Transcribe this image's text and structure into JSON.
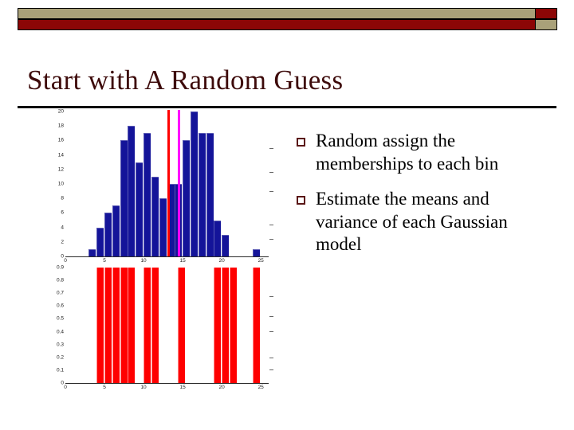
{
  "slide": {
    "title": "Start with A Random Guess",
    "title_color": "#3d0a0a",
    "decoration": {
      "top_bar_color": "#a9a179",
      "bottom_bar_color": "#8c0606",
      "outline_color": "#000000"
    },
    "bullets": [
      {
        "marker": "hollow-square",
        "text": "Random assign the memberships to each bin"
      },
      {
        "marker": "hollow-square",
        "text": "Estimate the means and variance of each Gaussian model"
      }
    ]
  },
  "chart_data": [
    {
      "type": "bar",
      "id": "histogram-counts",
      "title": "",
      "xlabel": "",
      "ylabel": "",
      "xlim": [
        0,
        26
      ],
      "ylim": [
        0,
        20
      ],
      "grid": false,
      "legend": null,
      "bar_color": "#141499",
      "xticks": [
        "0",
        "5",
        "10",
        "15",
        "20",
        "25"
      ],
      "xtick_values": [
        0,
        5,
        10,
        15,
        20,
        25
      ],
      "yticks": [
        "0",
        "2",
        "4",
        "6",
        "8",
        "10",
        "12",
        "14",
        "16",
        "18",
        "20"
      ],
      "ytick_values": [
        0,
        2,
        4,
        6,
        8,
        10,
        12,
        14,
        16,
        18,
        20
      ],
      "x": [
        3,
        4,
        5,
        6,
        7,
        8,
        9,
        10,
        11,
        12,
        13,
        14,
        15,
        16,
        17,
        18,
        19,
        20,
        21,
        22,
        24
      ],
      "values": [
        1,
        4,
        6,
        7,
        16,
        18,
        13,
        17,
        11,
        8,
        10,
        10,
        16,
        20,
        17,
        17,
        5,
        3,
        0,
        0,
        1
      ],
      "annotations": [
        {
          "type": "vline",
          "x": 13,
          "color": "#ff0000",
          "label": "mean-1"
        },
        {
          "type": "vline",
          "x": 14.4,
          "color": "#ff00ff",
          "label": "mean-2"
        }
      ]
    },
    {
      "type": "bar",
      "id": "membership-assignment",
      "title": "",
      "xlabel": "",
      "ylabel": "",
      "xlim": [
        0,
        26
      ],
      "ylim": [
        0,
        0.9
      ],
      "grid": false,
      "legend": null,
      "bar_color": "#fe0000",
      "xticks": [
        "0",
        "5",
        "10",
        "15",
        "20",
        "25"
      ],
      "xtick_values": [
        0,
        5,
        10,
        15,
        20,
        25
      ],
      "yticks": [
        "0",
        "0.1",
        "0.2",
        "0.3",
        "0.4",
        "0.5",
        "0.6",
        "0.7",
        "0.8",
        "0.9"
      ],
      "ytick_values": [
        0,
        0.1,
        0.2,
        0.3,
        0.4,
        0.5,
        0.6,
        0.7,
        0.8,
        0.9
      ],
      "x": [
        4,
        5,
        6,
        7,
        8,
        10,
        11,
        14.4,
        19,
        20,
        21,
        24
      ],
      "values": [
        0.9,
        0.9,
        0.9,
        0.9,
        0.9,
        0.9,
        0.9,
        0.9,
        0.9,
        0.9,
        0.9,
        0.9
      ]
    }
  ]
}
